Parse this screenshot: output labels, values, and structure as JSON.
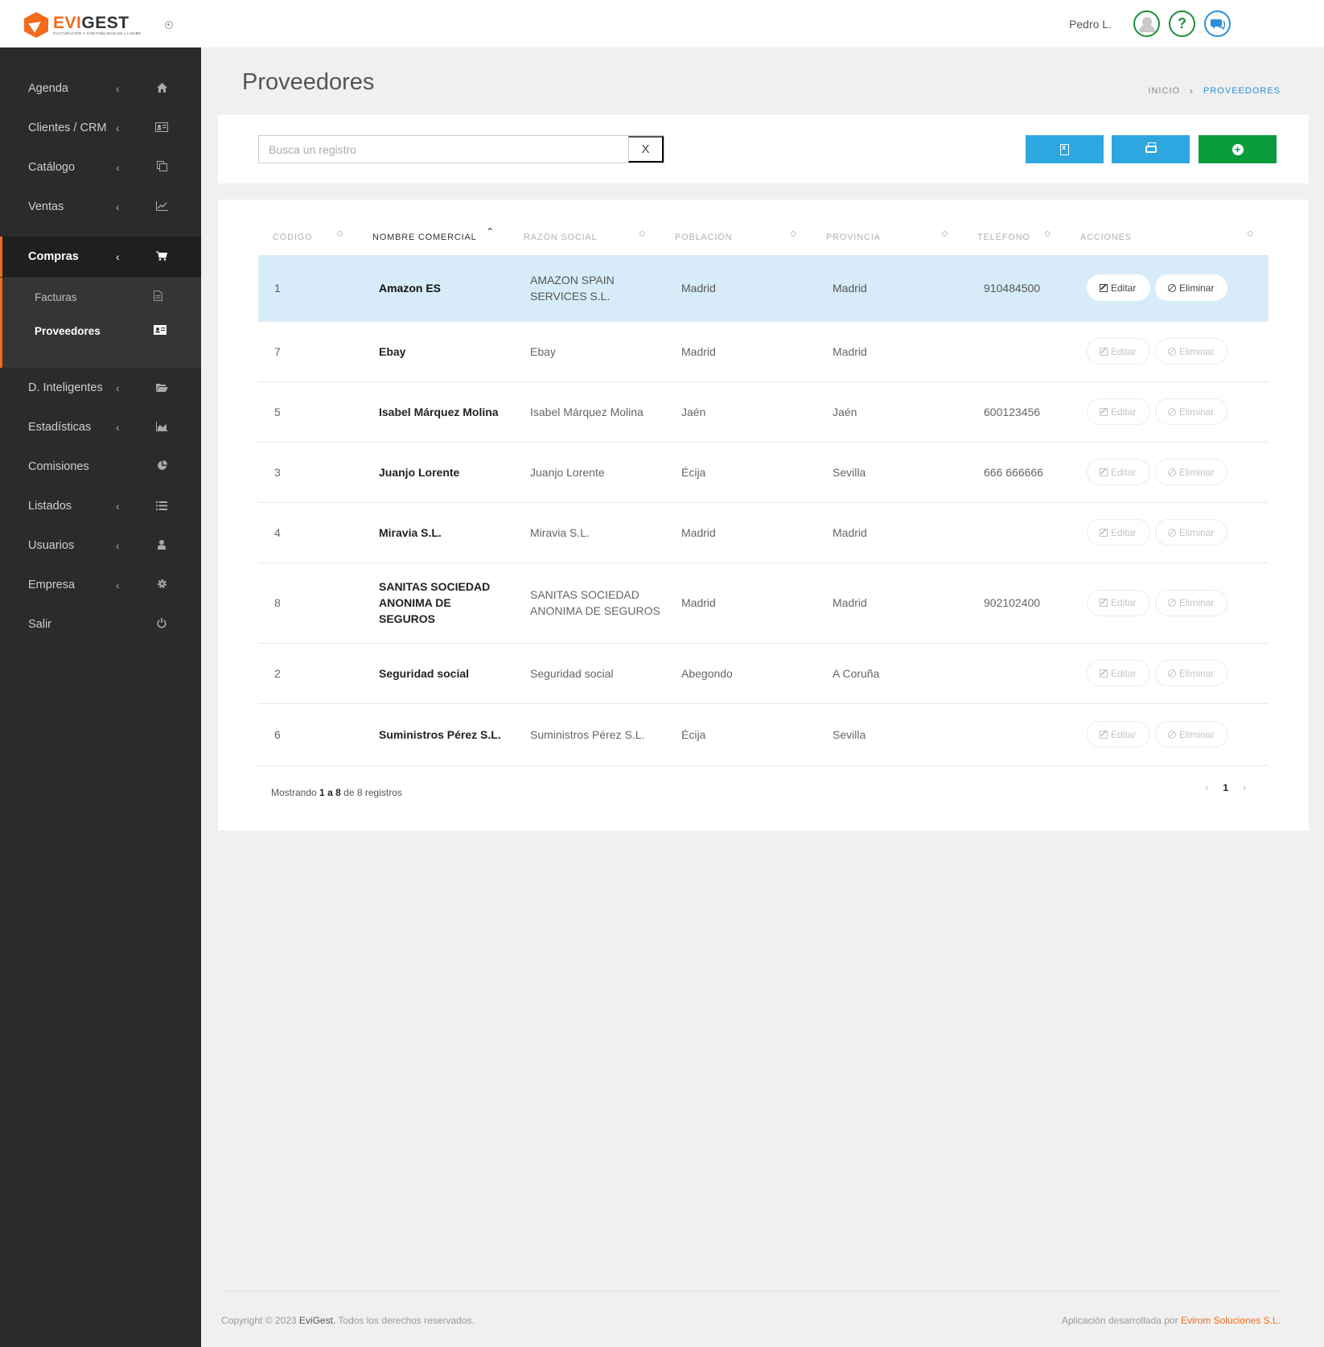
{
  "app": {
    "logo_primary": "EVI",
    "logo_secondary": "GEST",
    "logo_tagline": "FACTURACIÓN Y CONTABILIDAD EN LA NUBE",
    "brand_color": "#f26a1b"
  },
  "topbar": {
    "user_name": "Pedro L.",
    "help_glyph": "?",
    "icons": [
      "avatar-icon",
      "help-icon",
      "chat-icon"
    ]
  },
  "sidebar": {
    "items": [
      {
        "label": "Agenda",
        "icon": "home-icon",
        "chevron": "‹"
      },
      {
        "label": "Clientes / CRM",
        "icon": "id-card-icon",
        "chevron": "‹"
      },
      {
        "label": "Catálogo",
        "icon": "copy-icon",
        "chevron": "‹"
      },
      {
        "label": "Ventas",
        "icon": "line-chart-icon",
        "chevron": "‹"
      },
      {
        "label": "Compras",
        "icon": "cart-icon",
        "chevron": "‹"
      },
      {
        "label": "D. Inteligentes",
        "icon": "folder-open-icon",
        "chevron": "‹"
      },
      {
        "label": "Estadísticas",
        "icon": "area-chart-icon",
        "chevron": "‹"
      },
      {
        "label": "Comisiones",
        "icon": "pie-chart-icon"
      },
      {
        "label": "Listados",
        "icon": "list-icon",
        "chevron": "‹"
      },
      {
        "label": "Usuarios",
        "icon": "user-icon",
        "chevron": "‹"
      },
      {
        "label": "Empresa",
        "icon": "gear-icon",
        "chevron": "‹"
      },
      {
        "label": "Salir",
        "icon": "power-icon"
      }
    ],
    "active": "Compras",
    "submenu": [
      {
        "label": "Facturas",
        "icon": "file-icon"
      },
      {
        "label": "Proveedores",
        "icon": "id-card-icon",
        "current": true
      }
    ]
  },
  "page": {
    "title": "Proveedores",
    "breadcrumb": {
      "home": "INICIO",
      "separator": "›",
      "current": "PROVEEDORES"
    }
  },
  "search": {
    "placeholder": "Busca un registro",
    "value": "",
    "clear_label": "X"
  },
  "toolbar": {
    "buttons": [
      {
        "name": "export-excel",
        "icon": "file-excel-icon",
        "color": "#2ea7e0"
      },
      {
        "name": "print",
        "icon": "print-icon",
        "color": "#2ea7e0"
      },
      {
        "name": "add",
        "icon": "plus-circle-icon",
        "color": "#0a9c3c"
      }
    ]
  },
  "table": {
    "columns": [
      {
        "label": "CÓDIGO",
        "sort": "◇"
      },
      {
        "label": "NOMBRE COMERCIAL",
        "sort": "⌃",
        "sorted": true
      },
      {
        "label": "RAZÓN SOCIAL",
        "sort": "◇"
      },
      {
        "label": "POBLACIÓN",
        "sort": "◇"
      },
      {
        "label": "PROVINCIA",
        "sort": "◇"
      },
      {
        "label": "TELÉFONO",
        "sort": "◇"
      },
      {
        "label": "ACCIONES",
        "sort": "◇"
      }
    ],
    "rows": [
      {
        "code": "1",
        "name": "Amazon ES",
        "razon": "AMAZON SPAIN SERVICES S.L.",
        "poblacion": "Madrid",
        "provincia": "Madrid",
        "telefono": "910484500",
        "highlight": true
      },
      {
        "code": "7",
        "name": "Ebay",
        "razon": "Ebay",
        "poblacion": "Madrid",
        "provincia": "Madrid",
        "telefono": ""
      },
      {
        "code": "5",
        "name": "Isabel Márquez Molina",
        "razon": "Isabel Márquez Molina",
        "poblacion": "Jaén",
        "provincia": "Jaén",
        "telefono": "600123456"
      },
      {
        "code": "3",
        "name": "Juanjo Lorente",
        "razon": "Juanjo Lorente",
        "poblacion": "Écija",
        "provincia": "Sevilla",
        "telefono": "666 666666"
      },
      {
        "code": "4",
        "name": "Miravia S.L.",
        "razon": "Miravia S.L.",
        "poblacion": "Madrid",
        "provincia": "Madrid",
        "telefono": ""
      },
      {
        "code": "8",
        "name": "SANITAS SOCIEDAD ANONIMA DE SEGUROS",
        "razon": "SANITAS SOCIEDAD ANONIMA DE SEGUROS",
        "poblacion": "Madrid",
        "provincia": "Madrid",
        "telefono": "902102400"
      },
      {
        "code": "2",
        "name": "Seguridad social",
        "razon": "Seguridad social",
        "poblacion": "Abegondo",
        "provincia": "A Coruña",
        "telefono": ""
      },
      {
        "code": "6",
        "name": "Suministros Pérez S.L.",
        "razon": "Suministros Pérez S.L.",
        "poblacion": "Écija",
        "provincia": "Sevilla",
        "telefono": ""
      }
    ],
    "actions": {
      "edit": "Editar",
      "delete": "Eliminar"
    },
    "highlight_color": "#d7ecf8"
  },
  "pagination": {
    "prefix": "Mostrando",
    "from": "1",
    "to_word": "a",
    "to": "8",
    "of_word": "de",
    "total": "8",
    "suffix": "registros",
    "prev": "‹",
    "next": "›",
    "current_page": "1"
  },
  "footer": {
    "copyright_prefix": "Copyright © 2023",
    "brand": "EviGest.",
    "copyright_suffix": "Todos los derechos reservados.",
    "developed_by": "Aplicación desarrollada por",
    "company": "Evirom Soluciones S.L."
  }
}
